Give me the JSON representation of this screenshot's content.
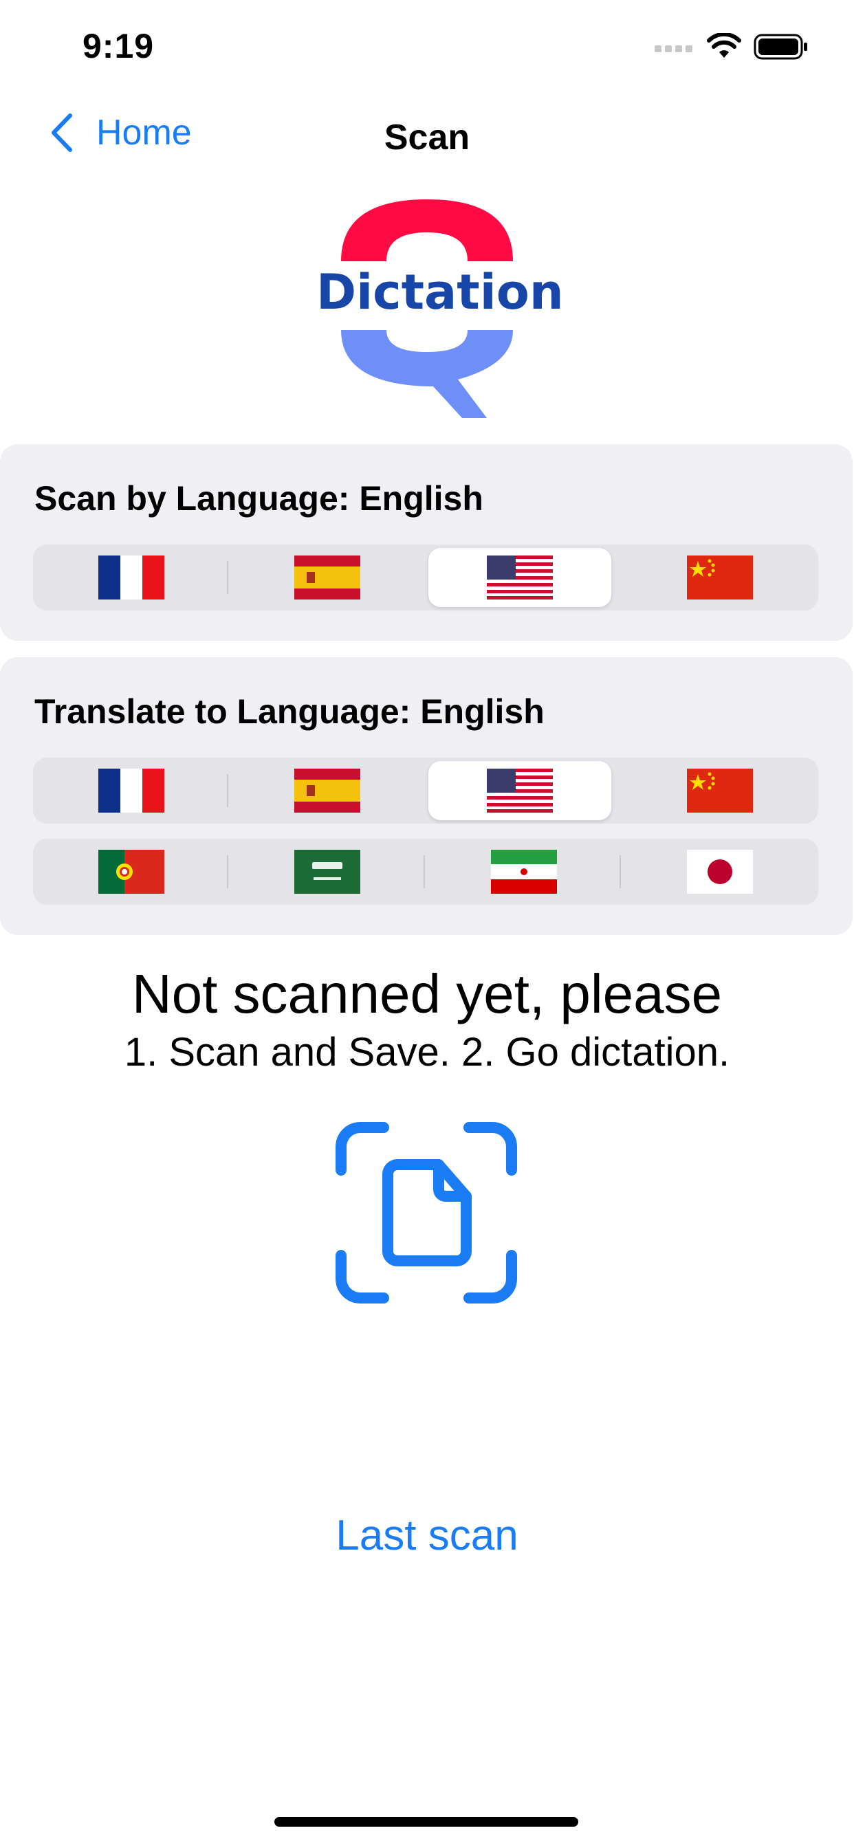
{
  "status_bar": {
    "time": "9:19"
  },
  "nav": {
    "back_label": "Home",
    "title": "Scan"
  },
  "logo": {
    "text": "Dictation"
  },
  "scan_language": {
    "label": "Scan by Language: English",
    "options": [
      "French",
      "Spanish",
      "English",
      "Chinese"
    ],
    "selected": "English"
  },
  "translate_language": {
    "label": "Translate to Language: English",
    "row1": [
      "French",
      "Spanish",
      "English",
      "Chinese"
    ],
    "row2": [
      "Portuguese",
      "Arabic",
      "Persian",
      "Japanese"
    ],
    "selected": "English"
  },
  "message": {
    "line1": "Not scanned yet, please",
    "line2": "1. Scan and Save. 2. Go dictation."
  },
  "last_scan_label": "Last scan",
  "colors": {
    "accent": "#1a7cf4",
    "card_bg": "#efeff4",
    "segment_bg": "#e3e3e8"
  }
}
